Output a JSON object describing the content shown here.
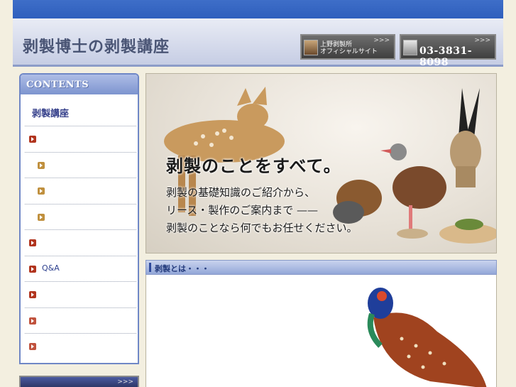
{
  "header": {
    "site_title": "剥製博士の剥製講座",
    "official_btn": {
      "line1": "上野剥製所",
      "line2": "オフィシャルサイト",
      "chevron": ">>>"
    },
    "phone_btn": {
      "number": "03-3831-8098",
      "chevron": ">>>"
    }
  },
  "sidebar": {
    "heading": "CONTENTS",
    "section_title": "剥製講座",
    "items": [
      {
        "label": "",
        "bullet": "red",
        "sub": false
      },
      {
        "label": "",
        "bullet": "tan",
        "sub": true
      },
      {
        "label": "",
        "bullet": "tan",
        "sub": true
      },
      {
        "label": "",
        "bullet": "tan",
        "sub": true
      },
      {
        "label": "",
        "bullet": "red",
        "sub": false
      },
      {
        "label": "Q&A",
        "bullet": "red",
        "sub": false
      },
      {
        "label": "",
        "bullet": "red",
        "sub": false
      },
      {
        "label": "",
        "bullet": "rose",
        "sub": false
      },
      {
        "label": "",
        "bullet": "rose",
        "sub": false
      }
    ],
    "bottom_chevron": ">>>"
  },
  "hero": {
    "headline": "剥製のことをすべて。",
    "line1": "剥製の基礎知識のご紹介から、",
    "line2": "リース・製作のご案内まで ——",
    "line3": "剥製のことなら何でもお任せください。"
  },
  "section": {
    "title": "剥製とは・・・"
  },
  "colors": {
    "topbar": "#3464c4",
    "accent": "#2c3f8e",
    "bullet_red": "#b1341e"
  }
}
